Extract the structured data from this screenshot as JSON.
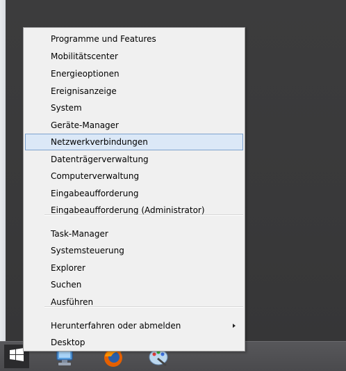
{
  "menu": {
    "items": [
      {
        "label": "Programme und Features",
        "name": "menu-item-programme-und-features"
      },
      {
        "label": "Mobilitätscenter",
        "name": "menu-item-mobilitaetscenter"
      },
      {
        "label": "Energieoptionen",
        "name": "menu-item-energieoptionen"
      },
      {
        "label": "Ereignisanzeige",
        "name": "menu-item-ereignisanzeige"
      },
      {
        "label": "System",
        "name": "menu-item-system"
      },
      {
        "label": "Geräte-Manager",
        "name": "menu-item-geraete-manager"
      },
      {
        "label": "Netzwerkverbindungen",
        "name": "menu-item-netzwerkverbindungen",
        "highlighted": true
      },
      {
        "label": "Datenträgerverwaltung",
        "name": "menu-item-datentraegerverwaltung"
      },
      {
        "label": "Computerverwaltung",
        "name": "menu-item-computerverwaltung"
      },
      {
        "label": "Eingabeaufforderung",
        "name": "menu-item-eingabeaufforderung"
      },
      {
        "label": "Eingabeaufforderung (Administrator)",
        "name": "menu-item-eingabeaufforderung-admin"
      },
      {
        "label": "Task-Manager",
        "name": "menu-item-task-manager"
      },
      {
        "label": "Systemsteuerung",
        "name": "menu-item-systemsteuerung"
      },
      {
        "label": "Explorer",
        "name": "menu-item-explorer"
      },
      {
        "label": "Suchen",
        "name": "menu-item-suchen"
      },
      {
        "label": "Ausführen",
        "name": "menu-item-ausfuehren"
      },
      {
        "label": "Herunterfahren oder abmelden",
        "name": "menu-item-herunterfahren",
        "submenu": true
      },
      {
        "label": "Desktop",
        "name": "menu-item-desktop"
      }
    ]
  },
  "taskbar": {
    "icons": [
      "windows-logo-icon",
      "internet-explorer-icon",
      "firefox-icon",
      "paint-icon"
    ]
  },
  "colors": {
    "menu_bg": "#f0f0f0",
    "highlight_bg": "#dbe8f7",
    "highlight_border": "#7da2ce",
    "desktop_bg": "#3a3a3b"
  }
}
